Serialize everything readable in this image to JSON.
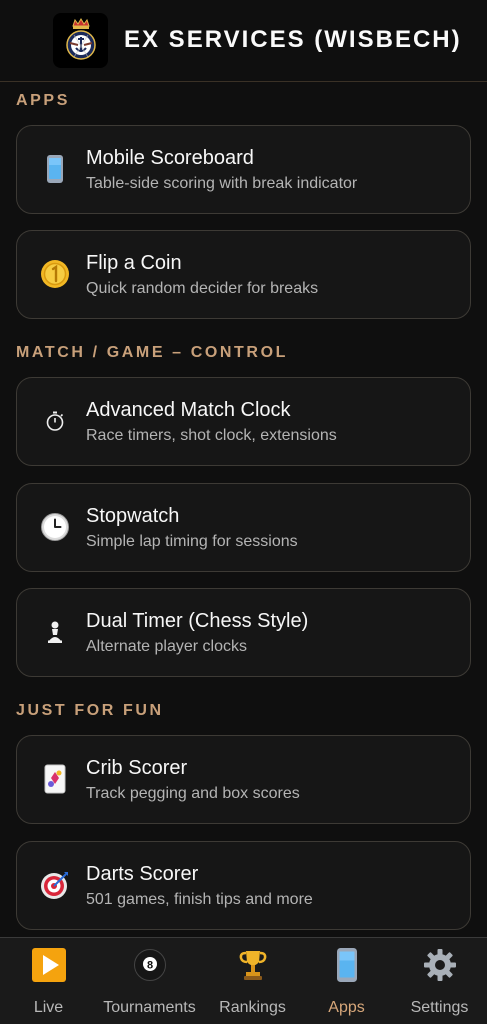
{
  "header": {
    "title": "EX SERVICES (WISBECH)"
  },
  "sections": [
    {
      "title": "APPS",
      "items": [
        {
          "title": "Mobile Scoreboard",
          "subtitle": "Table-side scoring with break indicator",
          "icon": "mobile-phone-icon"
        },
        {
          "title": "Flip a Coin",
          "subtitle": "Quick random decider for breaks",
          "icon": "coin-icon"
        }
      ]
    },
    {
      "title": "MATCH / GAME – CONTROL",
      "items": [
        {
          "title": "Advanced Match Clock",
          "subtitle": "Race timers, shot clock, extensions",
          "icon": "stopwatch-icon"
        },
        {
          "title": "Stopwatch",
          "subtitle": "Simple lap timing for sessions",
          "icon": "clock-icon"
        },
        {
          "title": "Dual Timer (Chess Style)",
          "subtitle": "Alternate player clocks",
          "icon": "chess-pawn-icon"
        }
      ]
    },
    {
      "title": "JUST FOR FUN",
      "items": [
        {
          "title": "Crib Scorer",
          "subtitle": "Track pegging and box scores",
          "icon": "playing-card-icon"
        },
        {
          "title": "Darts Scorer",
          "subtitle": "501 games, finish tips and more",
          "icon": "dartboard-icon"
        }
      ]
    }
  ],
  "nav": [
    {
      "label": "Live",
      "icon": "play-button-icon",
      "active": false
    },
    {
      "label": "Tournaments",
      "icon": "pool-8-ball-icon",
      "active": false
    },
    {
      "label": "Rankings",
      "icon": "trophy-icon",
      "active": false
    },
    {
      "label": "Apps",
      "icon": "mobile-phone-icon",
      "active": true
    },
    {
      "label": "Settings",
      "icon": "gear-icon",
      "active": false
    }
  ],
  "colors": {
    "background": "#0f0f0f",
    "accent": "#c8a07a",
    "active_nav": "#d7a77a",
    "card": "#161616",
    "card_border": "#3d3a35"
  }
}
